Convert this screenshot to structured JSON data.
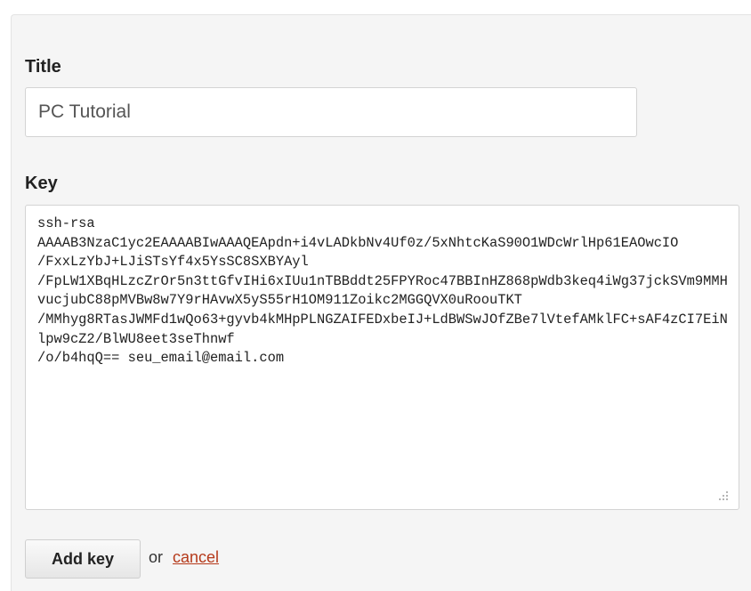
{
  "form": {
    "title_label": "Title",
    "title_value": "PC Tutorial",
    "key_label": "Key",
    "key_value": "ssh-rsa\nAAAAB3NzaC1yc2EAAAABIwAAAQEApdn+i4vLADkbNv4Uf0z/5xNhtcKaS90O1WDcWrlHp61EAOwcIO\n/FxxLzYbJ+LJiSTsYf4x5YsSC8SXBYAyl\n/FpLW1XBqHLzcZrOr5n3ttGfvIHi6xIUu1nTBBddt25FPYRoc47BBInHZ868pWdb3keq4iWg37jckSVm9MMHvucjubC88pMVBw8w7Y9rHAvwX5yS55rH1OM911Zoikc2MGGQVX0uRoouTKT\n/MMhyg8RTasJWMFd1wQo63+gyvb4kMHpPLNGZAIFEDxbeIJ+LdBWSwJOfZBe7lVtefAMklFC+sAF4zCI7EiNlpw9cZ2/BlWU8eet3seThnwf\n/o/b4hqQ== seu_email@email.com",
    "add_button_label": "Add key",
    "or_text": "or",
    "cancel_link_label": "cancel"
  },
  "colors": {
    "panel_background": "#f5f5f5",
    "link": "#b53a1b"
  },
  "icons": {
    "resize_handle": "resize-grip-icon"
  }
}
